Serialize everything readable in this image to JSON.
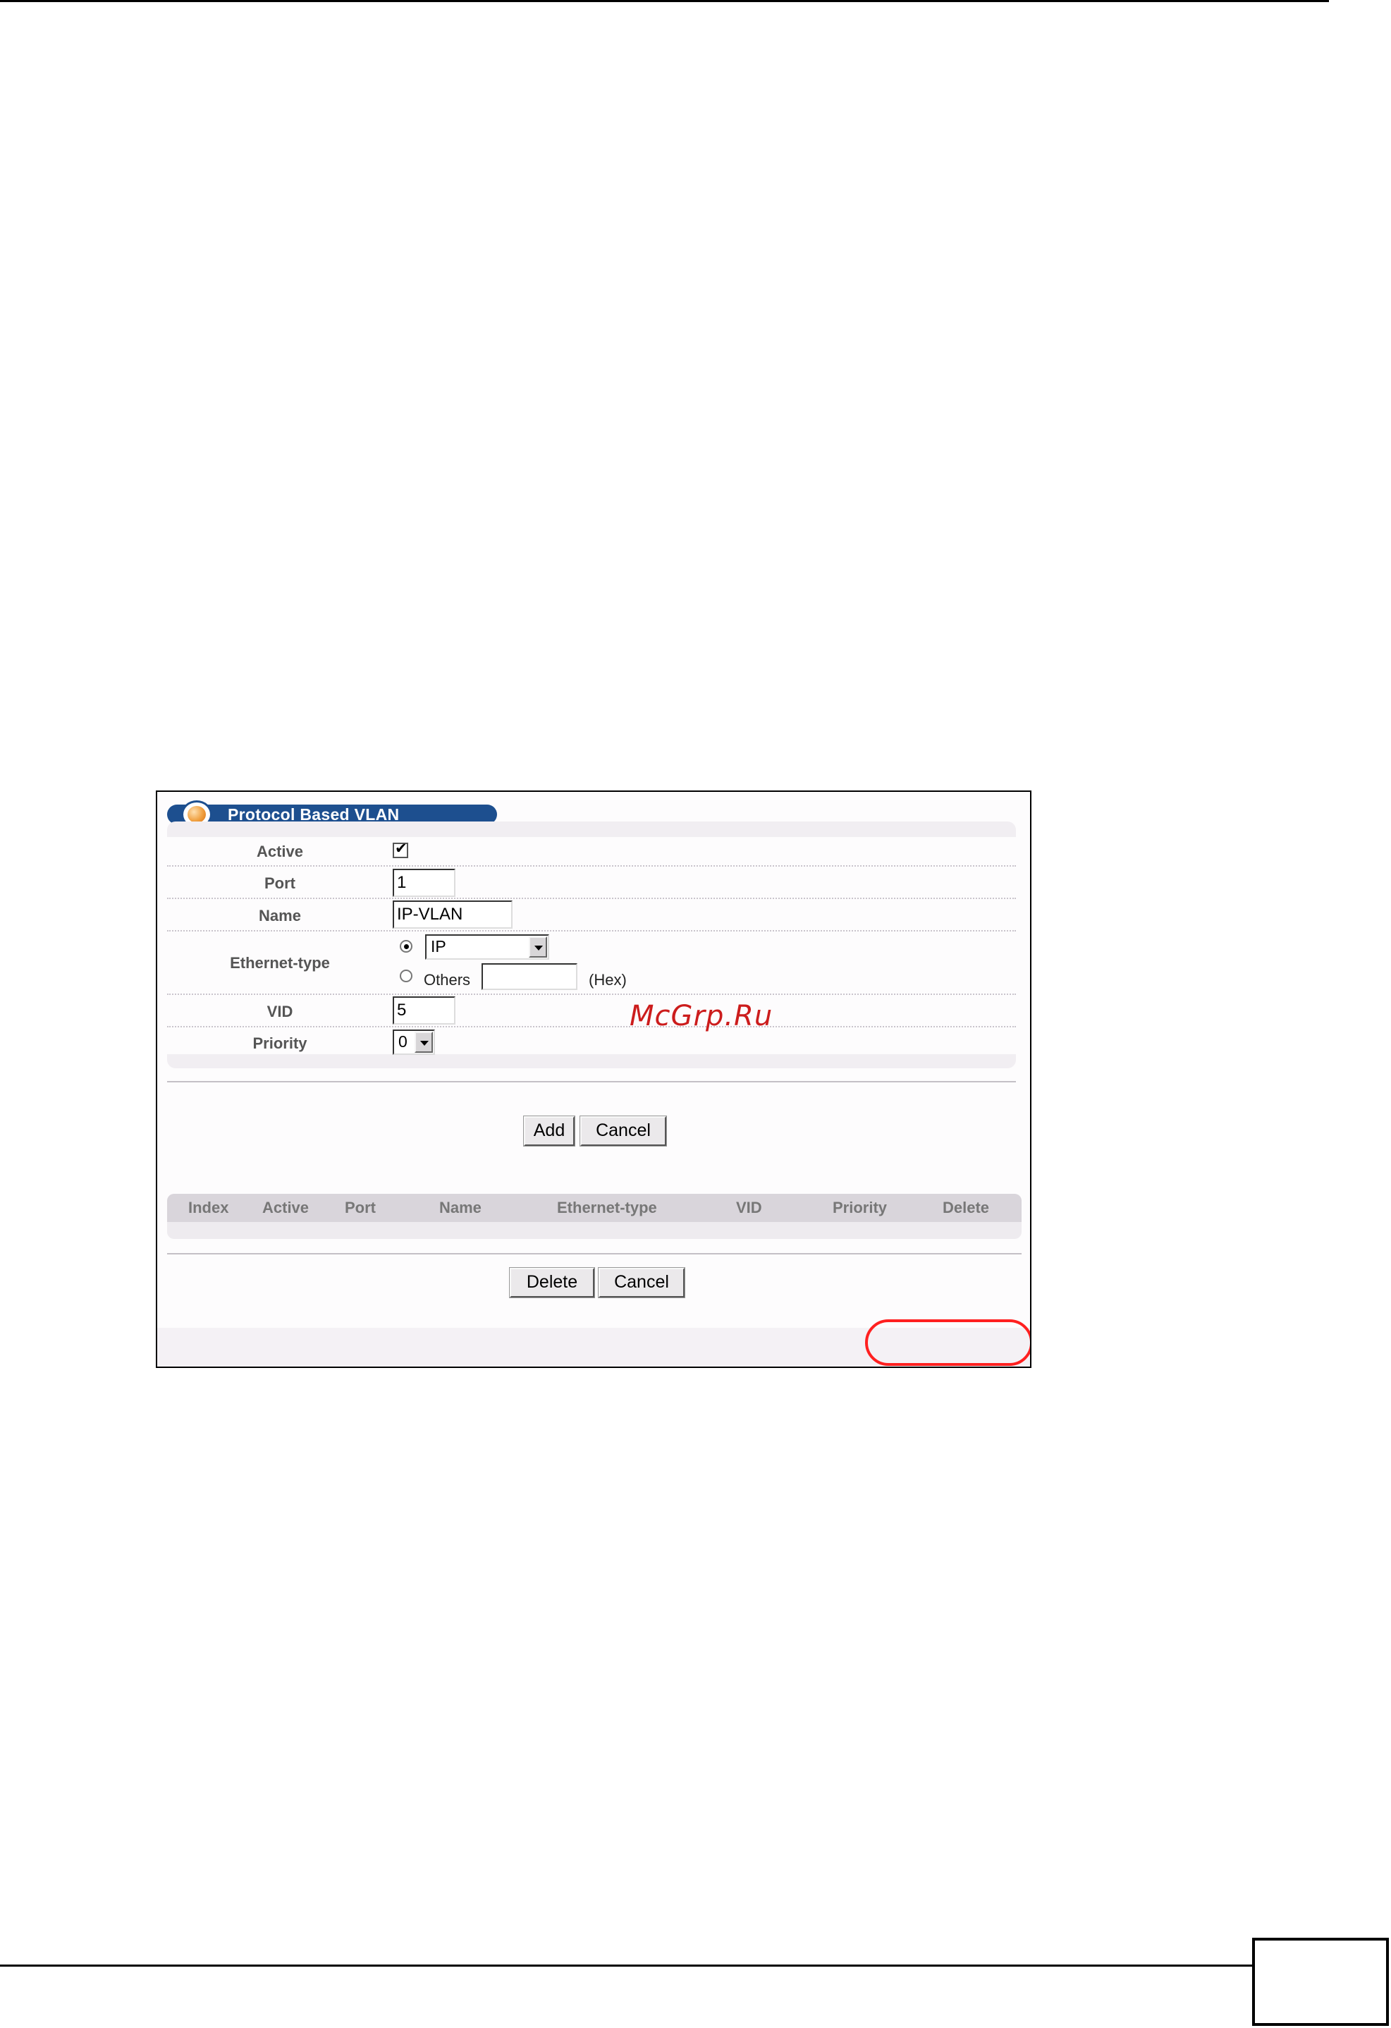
{
  "screen": {
    "title": "Protocol Based VLAN",
    "form": {
      "active": {
        "label": "Active",
        "checked": true
      },
      "port": {
        "label": "Port",
        "value": "1"
      },
      "name": {
        "label": "Name",
        "value": "IP-VLAN"
      },
      "ethernet_type": {
        "label": "Ethernet-type",
        "selected_option": "ip",
        "ip_select_value": "IP",
        "others_label": "Others",
        "others_value": "",
        "hex_label": "(Hex)"
      },
      "vid": {
        "label": "VID",
        "value": "5"
      },
      "priority": {
        "label": "Priority",
        "value": "0"
      }
    },
    "buttons": {
      "add": "Add",
      "cancel": "Cancel",
      "delete": "Delete",
      "cancel2": "Cancel"
    },
    "table": {
      "columns": [
        "Index",
        "Active",
        "Port",
        "Name",
        "Ethernet-type",
        "VID",
        "Priority",
        "Delete"
      ],
      "rows": []
    }
  },
  "watermark": "McGrp.Ru",
  "colors": {
    "title_bar": "#1d4f8f",
    "panel_bg": "#f1eef2",
    "highlight_ellipse": "#ff2020",
    "watermark": "#cc1c1c"
  }
}
